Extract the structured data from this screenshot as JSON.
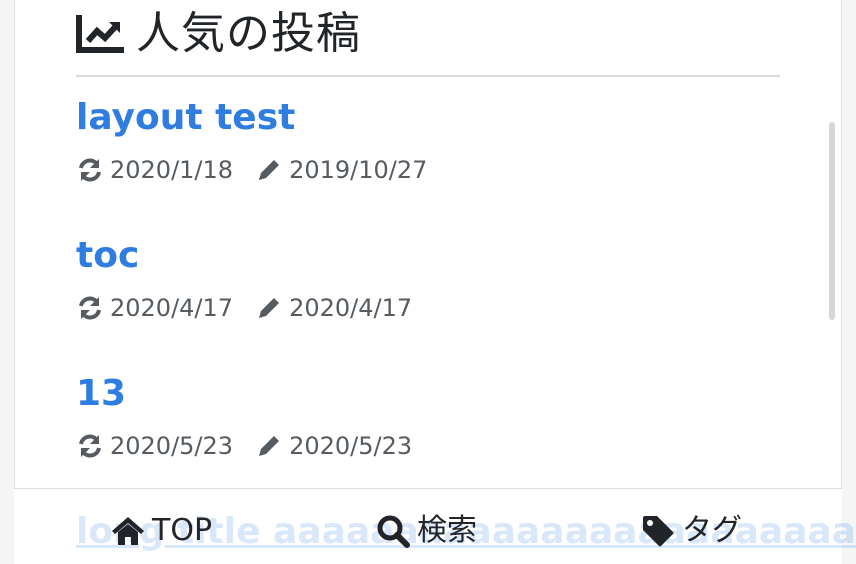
{
  "section": {
    "title": "人気の投稿",
    "icon": "chart-line-icon"
  },
  "posts": [
    {
      "title": "layout test",
      "updated": "2020/1/18",
      "created": "2019/10/27"
    },
    {
      "title": "toc",
      "updated": "2020/4/17",
      "created": "2020/4/17"
    },
    {
      "title": "13",
      "updated": "2020/5/23",
      "created": "2020/5/23"
    }
  ],
  "partially_hidden_post": {
    "title": "long title aaaaaaaaaaaaaaaaaaaaaaaaaaa"
  },
  "bottom_nav": {
    "top_label": "TOP",
    "search_label": "検索",
    "tags_label": "タグ"
  },
  "colors": {
    "link": "#2f7de1",
    "meta_text": "#555b61",
    "heading_text": "#212529"
  }
}
